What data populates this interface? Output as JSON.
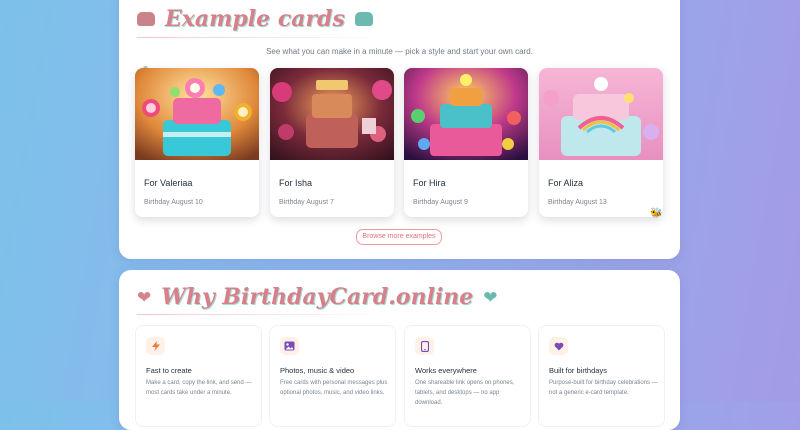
{
  "examples": {
    "title": "Example cards",
    "subtitle": "See what you can make in a minute — pick a style and start your own card.",
    "cards": [
      {
        "name": "For Valeriaa",
        "date": "Birthday August 10"
      },
      {
        "name": "For Isha",
        "date": "Birthday August 7"
      },
      {
        "name": "For Hira",
        "date": "Birthday August 9"
      },
      {
        "name": "For Aliza",
        "date": "Birthday August 13"
      }
    ],
    "browse_label": "Browse more examples"
  },
  "why": {
    "title": "Why BirthdayCard.online",
    "features": [
      {
        "icon": "lightning-icon",
        "title": "Fast to create",
        "desc": "Make a card, copy the link, and send — most cards take under a minute."
      },
      {
        "icon": "image-icon",
        "title": "Photos, music & video",
        "desc": "Free cards with personal messages plus optional photos, music, and video links."
      },
      {
        "icon": "phone-icon",
        "title": "Works everywhere",
        "desc": "One shareable link opens on phones, tablets, and desktops — no app download."
      },
      {
        "icon": "heart-icon",
        "title": "Built for birthdays",
        "desc": "Purpose-built for birthday celebrations — not a generic e-card template."
      }
    ]
  },
  "colors": {
    "title_pink": "#d87f8a",
    "title_shadow_teal": "#a7dcd6",
    "accent_coral": "#e0707a",
    "icon_bg": "#fff1e8",
    "icon_orange": "#ea7b3c",
    "icon_purple": "#7b4bb8",
    "background_blue": "#7cc1ea",
    "background_purple": "#a39be6"
  }
}
